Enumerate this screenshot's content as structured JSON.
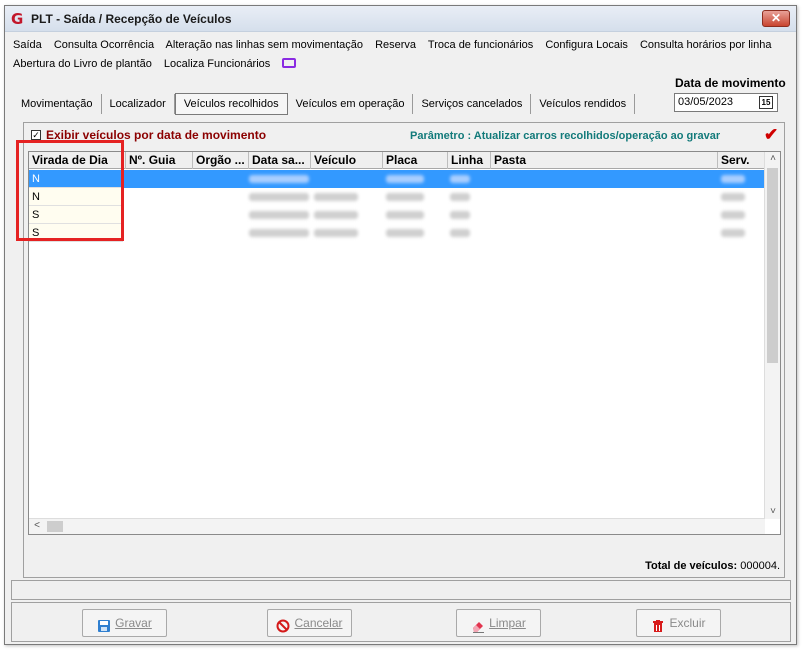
{
  "window": {
    "title": "PLT - Saída / Recepção de Veículos",
    "close_symbol": "✕",
    "logo_letter": "G"
  },
  "menu": {
    "row1": [
      "Saída",
      "Consulta Ocorrência",
      "Alteração nas linhas sem movimentação",
      "Reserva",
      "Troca de funcionários",
      "Configura Locais",
      "Consulta horários por linha"
    ],
    "row2": [
      "Abertura do Livro de plantão",
      "Localiza Funcionários"
    ],
    "monitor_icon": "monitor-icon"
  },
  "tabs": [
    "Movimentação",
    "Localizador",
    "Veículos recolhidos",
    "Veículos em operação",
    "Serviços cancelados",
    "Veículos rendidos"
  ],
  "active_tab": "Veículos recolhidos",
  "date": {
    "label": "Data de movimento",
    "value": "03/05/2023",
    "calendar_icon_text": "15"
  },
  "filter": {
    "checkbox_checked": true,
    "checkbox_mark": "✓",
    "label": "Exibir veículos por data de movimento",
    "param_text": "Parâmetro : Atualizar carros recolhidos/operação ao gravar",
    "confirm_mark": "✔"
  },
  "grid": {
    "columns": [
      "Virada de Dia",
      "Nº. Guia",
      "Orgão ...",
      "Data sa...",
      "Veículo",
      "Placa",
      "Linha",
      "Pasta",
      "Serv."
    ],
    "rows": [
      {
        "virada": "N",
        "selected": true
      },
      {
        "virada": "N",
        "selected": false
      },
      {
        "virada": "S",
        "selected": false
      },
      {
        "virada": "S",
        "selected": false
      }
    ],
    "scroll_up": "˄",
    "scroll_down": "˅",
    "scroll_left": "<"
  },
  "total": {
    "label": "Total de veículos:",
    "value": "000004."
  },
  "buttons": {
    "save": "Gravar",
    "cancel": "Cancelar",
    "clear": "Limpar",
    "delete": "Excluir"
  },
  "colors": {
    "selection": "#3399ff",
    "highlight_box": "#e52222",
    "filter_label": "#8b0000",
    "param_text": "#127a7a"
  }
}
